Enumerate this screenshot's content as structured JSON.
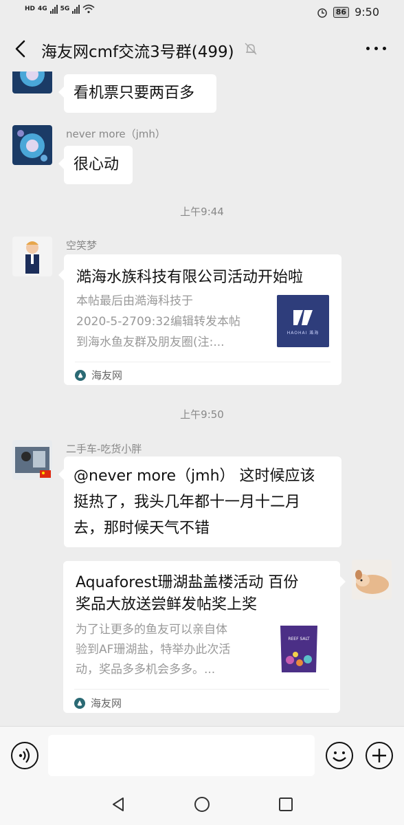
{
  "status_bar": {
    "left_labels": [
      "HD",
      "4G",
      "5G"
    ],
    "battery": "86",
    "time": "9:50"
  },
  "header": {
    "title": "海友网cmf交流3号群(499)",
    "icons": [
      "back-arrow-icon",
      "mute-bell-icon",
      "more-dots-icon"
    ]
  },
  "messages": [
    {
      "type": "text",
      "sender": "",
      "text": "看机票只要两百多"
    },
    {
      "type": "text",
      "sender": "never more（jmh）",
      "text": "很心动"
    },
    {
      "type": "time",
      "text": "上午9:44"
    },
    {
      "type": "card",
      "sender": "空笑梦",
      "title": "澔海水族科技有限公司活动开始啦",
      "desc_lines": [
        "本帖最后由澔海科技于",
        "2020-5-2709:32编辑转发本帖",
        "到海水鱼友群及朋友圈(注:..."
      ],
      "source": "海友网",
      "thumb_text": "HAOHAI 澔海"
    },
    {
      "type": "time",
      "text": "上午9:50"
    },
    {
      "type": "text",
      "sender": "二手车-吃货小胖",
      "lines": [
        "@never more（jmh） 这时候应该",
        "挺热了，我头几年都十一月十二月",
        "去，那时候天气不错"
      ]
    },
    {
      "type": "card_outgoing",
      "title_lines": [
        "Aquaforest珊湖盐盖楼活动 百份",
        "奖品大放送尝鲜发帖奖上奖"
      ],
      "desc_lines": [
        "为了让更多的鱼友可以亲自体",
        "验到AF珊湖盐，特举办此次活",
        "动，奖品多多机会多多。..."
      ],
      "source": "海友网",
      "thumb_text": "REEF SALT"
    }
  ],
  "input_bar": {
    "placeholder": "",
    "icons": [
      "voice-icon",
      "emoji-icon",
      "plus-icon"
    ]
  },
  "nav_bar": {
    "icons": [
      "nav-back-icon",
      "nav-home-icon",
      "nav-recents-icon"
    ]
  }
}
